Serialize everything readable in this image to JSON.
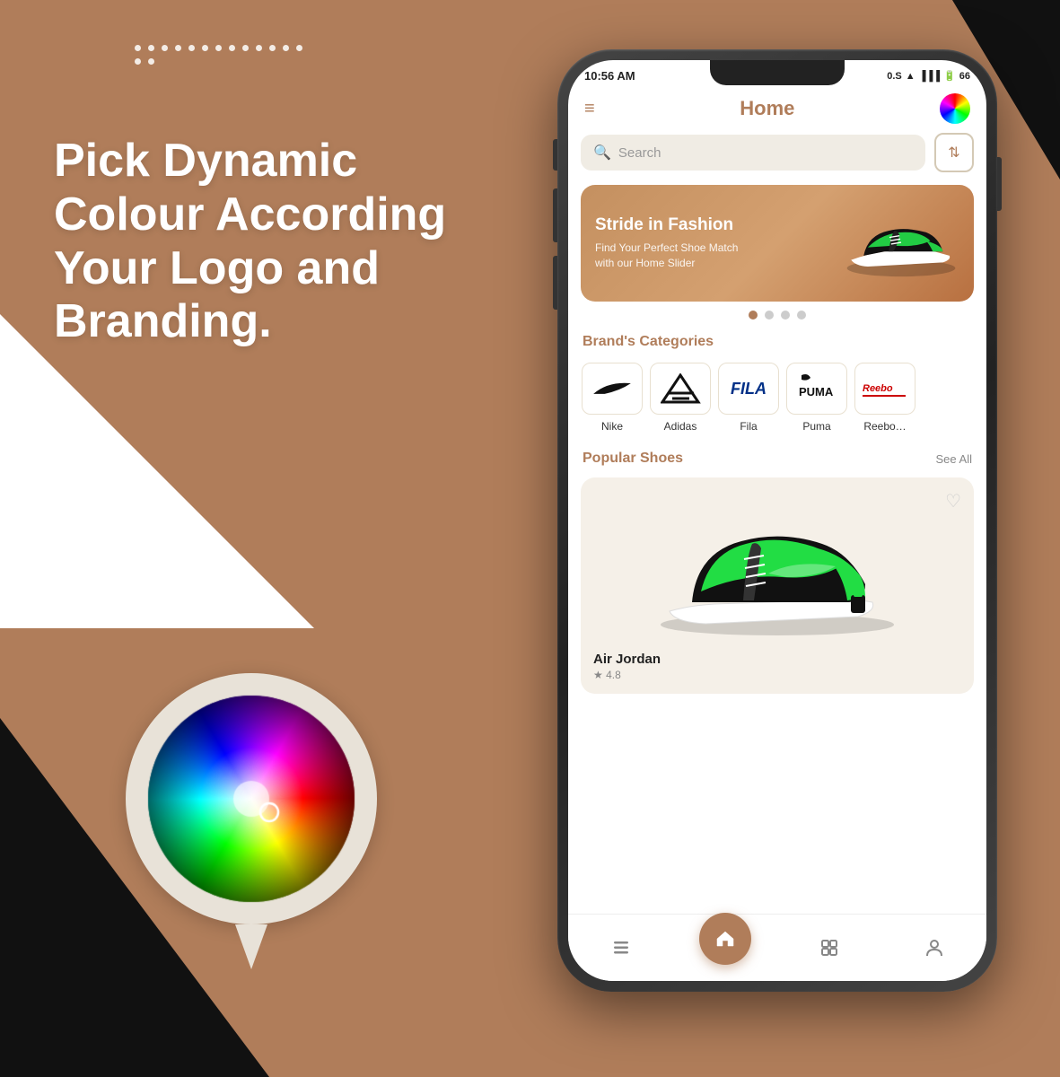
{
  "background_color": "#b07d5a",
  "headline": {
    "line1": "Pick Dynamic",
    "line2": "Colour According",
    "line3": "Your Logo and Branding."
  },
  "phone": {
    "status_bar": {
      "time": "10:56 AM",
      "signal": "0.S",
      "battery": "66"
    },
    "header": {
      "title": "Home",
      "hamburger_label": "≡",
      "color_picker_label": "color-picker"
    },
    "search": {
      "placeholder": "Search",
      "filter_icon": "⇅"
    },
    "banner": {
      "title": "Stride in Fashion",
      "subtitle": "Find Your Perfect Shoe Match\nwith our Home Slider"
    },
    "dots": [
      "active",
      "inactive",
      "inactive",
      "inactive"
    ],
    "brands_section": {
      "title": "Brand's Categories",
      "brands": [
        {
          "name": "Nike",
          "logo_type": "nike"
        },
        {
          "name": "Adidas",
          "logo_type": "adidas"
        },
        {
          "name": "Fila",
          "logo_type": "fila"
        },
        {
          "name": "Puma",
          "logo_type": "puma"
        },
        {
          "name": "Reebok",
          "logo_type": "reebok"
        }
      ]
    },
    "popular_section": {
      "title": "Popular Shoes",
      "see_all_label": "See All",
      "shoe": {
        "name": "Air Jordan",
        "rating": "4.8"
      }
    },
    "bottom_nav": [
      {
        "icon": "⊞",
        "label": "menu",
        "active": false
      },
      {
        "icon": "⌂",
        "label": "home",
        "active": true
      },
      {
        "icon": "☰",
        "label": "list",
        "active": false
      },
      {
        "icon": "☻",
        "label": "profile",
        "active": false
      }
    ]
  }
}
